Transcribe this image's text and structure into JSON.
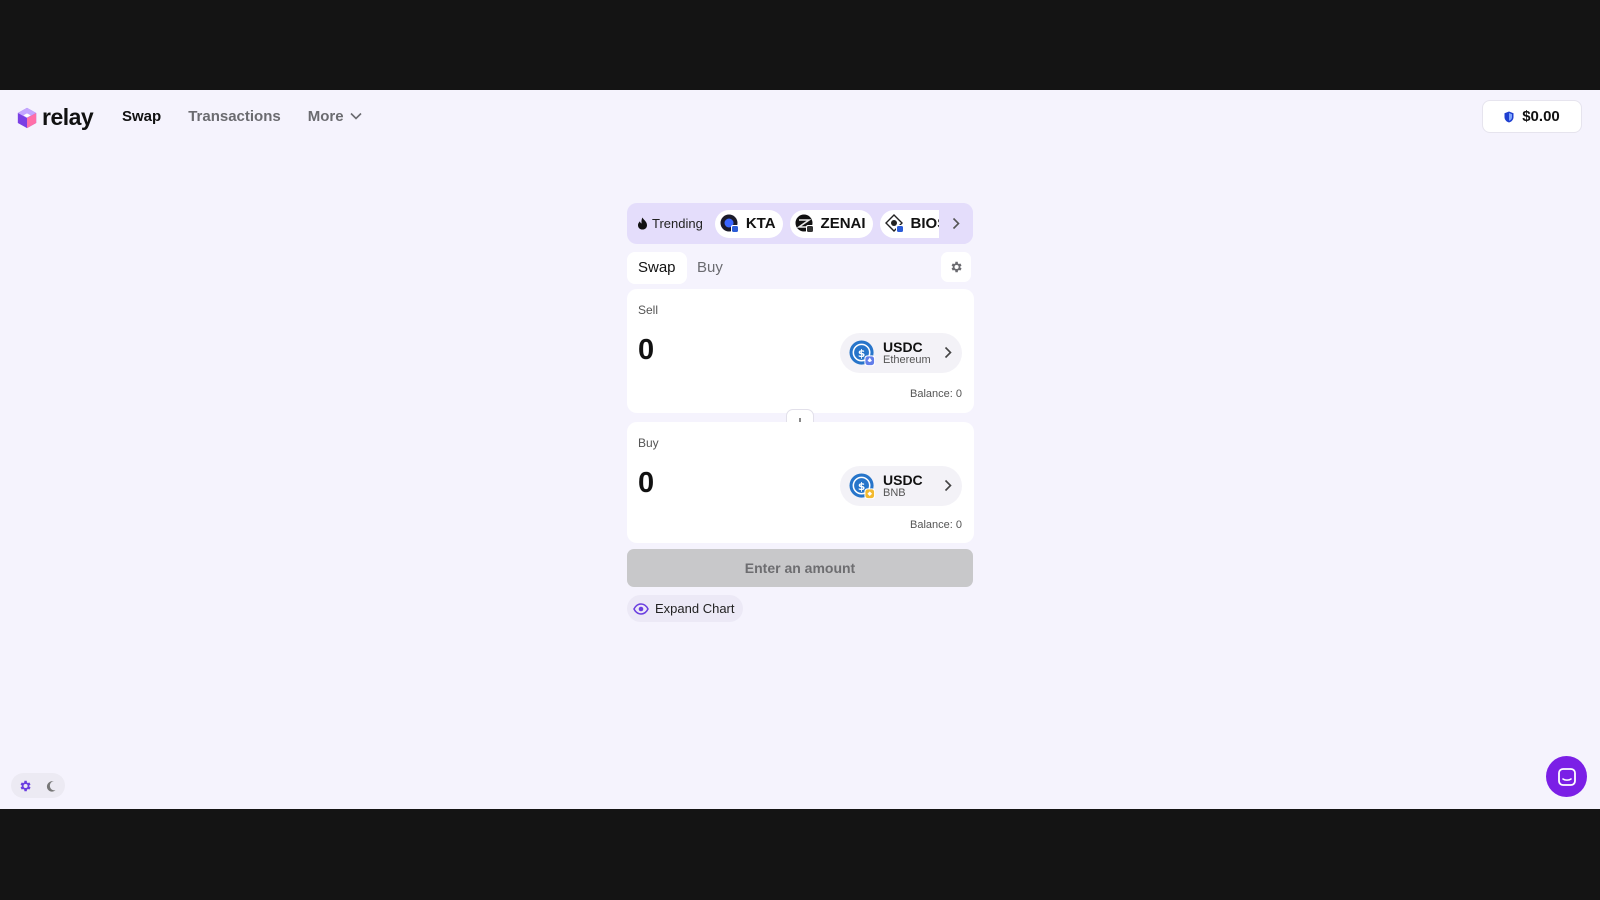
{
  "brand": {
    "name": "relay"
  },
  "nav": [
    {
      "label": "Swap"
    },
    {
      "label": "Transactions"
    },
    {
      "label": "More"
    }
  ],
  "wallet": {
    "balance": "$0.00"
  },
  "trending": {
    "label": "Trending",
    "tokens": [
      {
        "symbol": "KTA"
      },
      {
        "symbol": "ZENAI"
      },
      {
        "symbol": "BIOS"
      }
    ]
  },
  "tabs": [
    {
      "label": "Swap"
    },
    {
      "label": "Buy"
    }
  ],
  "sell": {
    "label": "Sell",
    "amount": "0",
    "token": "USDC",
    "chain": "Ethereum",
    "balance": "Balance: 0"
  },
  "buy": {
    "label": "Buy",
    "amount": "0",
    "token": "USDC",
    "chain": "BNB",
    "balance": "Balance: 0"
  },
  "cta": {
    "label": "Enter an amount"
  },
  "chart_toggle": {
    "label": "Expand Chart"
  },
  "colors": {
    "accent": "#7b1fe6",
    "usdc": "#2775ca",
    "ethereum": "#627eea",
    "bnb": "#f3ba2f"
  }
}
